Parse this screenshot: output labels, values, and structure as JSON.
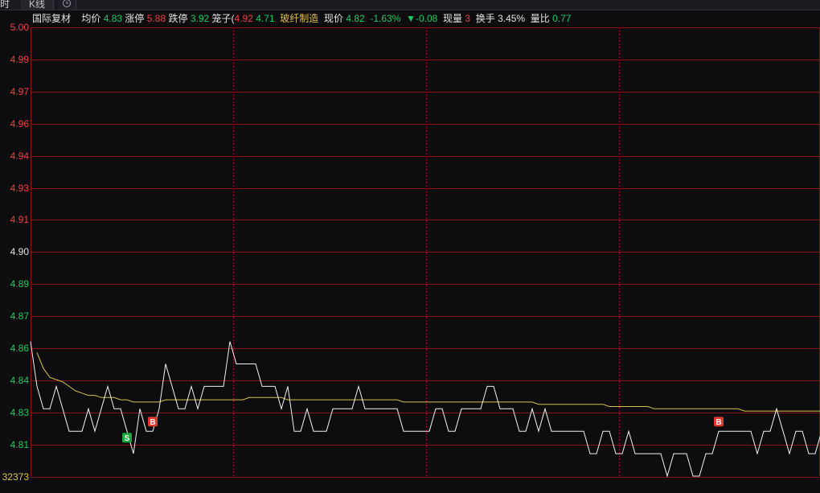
{
  "tabs": {
    "tab1_label": "时",
    "tab2_label": "K线",
    "tab3_icon": "clock-icon"
  },
  "header": {
    "name": "国际复材",
    "avg_label": "均价",
    "avg_value": "4.83",
    "limit_up_label": "涨停",
    "limit_up_value": "5.88",
    "limit_down_label": "跌停",
    "limit_down_value": "3.92",
    "cage_label": "笼子(",
    "cage_high": "4.92",
    "cage_low": "4.71",
    "sector": "玻纤制造",
    "price_label": "现价",
    "price_value": "4.82",
    "pct_change": "-1.63%",
    "change_arrow": "▼",
    "change_value": "-0.08",
    "volume_label": "现量",
    "volume_value": "3",
    "turnover_label": "换手",
    "turnover_value": "3.45%",
    "ratio_label": "量比",
    "ratio_value": "0.77"
  },
  "y_axis": {
    "ticks": [
      {
        "label": "5.00",
        "color": "#f04040"
      },
      {
        "label": "4.99",
        "color": "#f04040"
      },
      {
        "label": "4.97",
        "color": "#f04040"
      },
      {
        "label": "4.96",
        "color": "#f04040"
      },
      {
        "label": "4.94",
        "color": "#f04040"
      },
      {
        "label": "4.93",
        "color": "#f04040"
      },
      {
        "label": "4.91",
        "color": "#f04040"
      },
      {
        "label": "4.90",
        "color": "#e4e4e4"
      },
      {
        "label": "4.89",
        "color": "#1ec95e"
      },
      {
        "label": "4.87",
        "color": "#1ec95e"
      },
      {
        "label": "4.86",
        "color": "#1ec95e"
      },
      {
        "label": "4.84",
        "color": "#1ec95e"
      },
      {
        "label": "4.83",
        "color": "#1ec95e"
      },
      {
        "label": "4.81",
        "color": "#1ec95e"
      }
    ],
    "volume_label": "32373"
  },
  "colors": {
    "grid": "#8a1414",
    "price_line": "#f2f2f2",
    "avg_line": "#d8c04a",
    "buy_marker": "#e03a2e",
    "sell_marker": "#1aa83c"
  },
  "chart_data": {
    "type": "line",
    "ylim": [
      4.8,
      5.0
    ],
    "series": [
      {
        "name": "",
        "values": [
          4.86,
          4.84,
          4.83,
          4.83,
          4.84,
          4.83,
          4.82,
          4.82,
          4.82,
          4.83,
          4.82,
          4.83,
          4.84,
          4.83,
          4.83,
          4.82,
          4.81,
          4.83,
          4.82,
          4.82,
          4.83,
          4.85,
          4.84,
          4.83,
          4.83,
          4.84,
          4.83,
          4.84,
          4.84,
          4.84,
          4.84,
          4.86,
          4.85,
          4.85,
          4.85,
          4.85,
          4.84,
          4.84,
          4.84,
          4.83,
          4.84,
          4.82,
          4.82,
          4.83,
          4.82,
          4.82,
          4.82,
          4.83,
          4.83,
          4.83,
          4.83,
          4.84,
          4.83,
          4.83,
          4.83,
          4.83,
          4.83,
          4.83,
          4.82,
          4.82,
          4.82,
          4.82,
          4.82,
          4.83,
          4.83,
          4.82,
          4.82,
          4.83,
          4.83,
          4.83,
          4.83,
          4.84,
          4.84,
          4.83,
          4.83,
          4.83,
          4.82,
          4.82,
          4.83,
          4.82,
          4.83,
          4.82,
          4.82,
          4.82,
          4.82,
          4.82,
          4.82,
          4.81,
          4.81,
          4.82,
          4.82,
          4.81,
          4.81,
          4.82,
          4.81,
          4.81,
          4.81,
          4.81,
          4.81,
          4.8,
          4.81,
          4.81,
          4.81,
          4.8,
          4.8,
          4.81,
          4.81,
          4.82,
          4.82,
          4.82,
          4.82,
          4.82,
          4.82,
          4.81,
          4.82,
          4.82,
          4.83,
          4.82,
          4.81,
          4.82,
          4.82,
          4.81,
          4.81,
          4.82,
          4.82,
          4.81,
          4.82
        ]
      },
      {
        "name": "",
        "values": [
          4.86,
          4.855,
          4.848,
          4.844,
          4.843,
          4.842,
          4.84,
          4.838,
          4.837,
          4.836,
          4.836,
          4.835,
          4.835,
          4.835,
          4.834,
          4.834,
          4.833,
          4.833,
          4.833,
          4.833,
          4.833,
          4.834,
          4.834,
          4.834,
          4.834,
          4.834,
          4.834,
          4.834,
          4.834,
          4.834,
          4.834,
          4.834,
          4.834,
          4.834,
          4.835,
          4.835,
          4.835,
          4.835,
          4.835,
          4.835,
          4.834,
          4.834,
          4.834,
          4.834,
          4.834,
          4.834,
          4.834,
          4.834,
          4.834,
          4.834,
          4.834,
          4.834,
          4.834,
          4.834,
          4.834,
          4.834,
          4.834,
          4.834,
          4.833,
          4.833,
          4.833,
          4.833,
          4.833,
          4.833,
          4.833,
          4.833,
          4.833,
          4.833,
          4.833,
          4.833,
          4.833,
          4.833,
          4.833,
          4.833,
          4.833,
          4.833,
          4.833,
          4.833,
          4.833,
          4.832,
          4.832,
          4.832,
          4.832,
          4.832,
          4.832,
          4.832,
          4.832,
          4.832,
          4.832,
          4.832,
          4.831,
          4.831,
          4.831,
          4.831,
          4.831,
          4.831,
          4.831,
          4.83,
          4.83,
          4.83,
          4.83,
          4.83,
          4.83,
          4.83,
          4.83,
          4.83,
          4.83,
          4.83,
          4.83,
          4.83,
          4.83,
          4.829,
          4.829,
          4.829,
          4.829,
          4.829,
          4.829,
          4.829,
          4.829,
          4.829,
          4.829,
          4.829,
          4.829,
          4.829,
          4.829,
          4.829,
          4.829
        ]
      }
    ],
    "markers": [
      {
        "label": "S",
        "index": 15,
        "type": "sell"
      },
      {
        "label": "B",
        "index": 19,
        "type": "buy"
      },
      {
        "label": "B",
        "index": 107,
        "type": "buy"
      }
    ]
  }
}
